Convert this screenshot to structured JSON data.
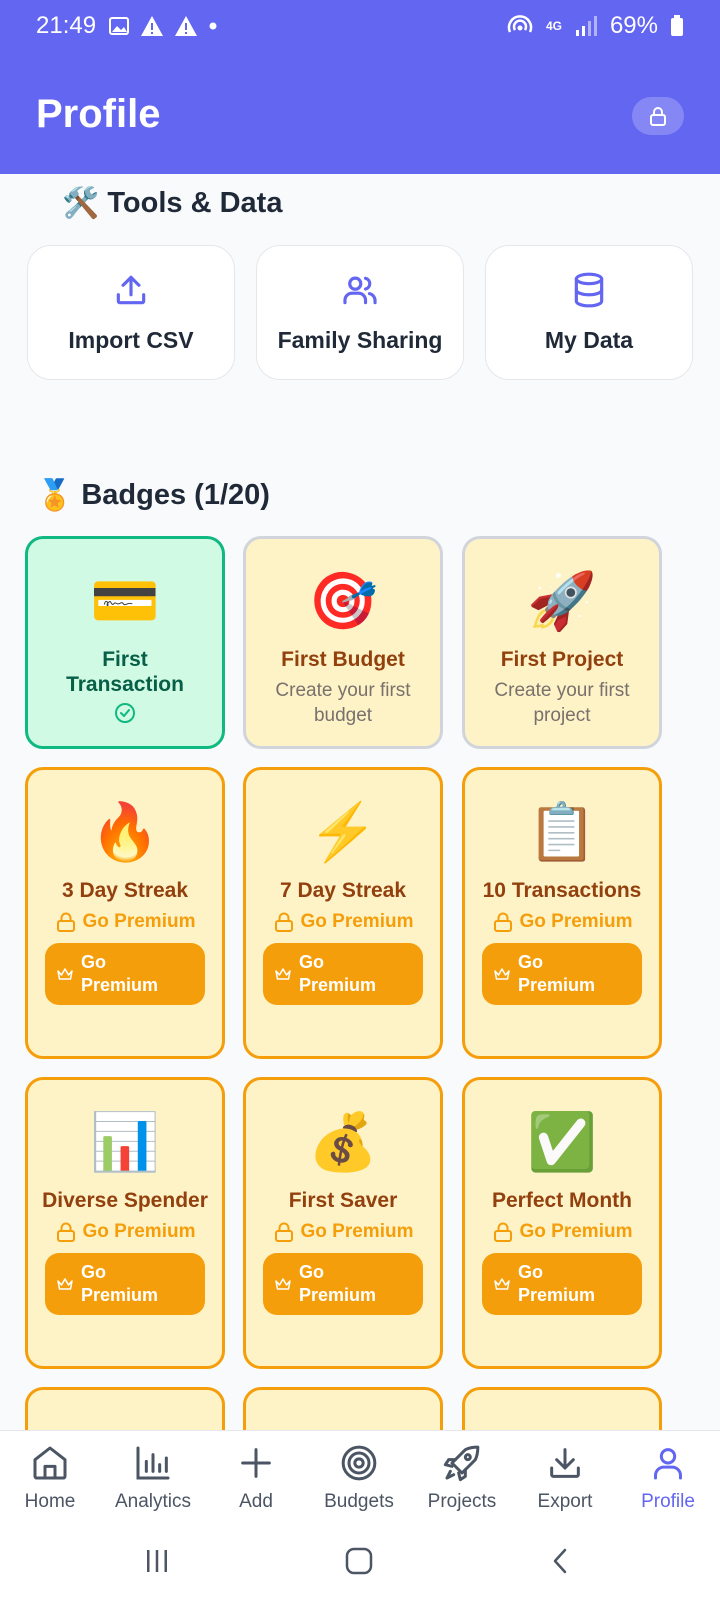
{
  "status_bar": {
    "time": "21:49",
    "battery": "69%",
    "network": "4G"
  },
  "header": {
    "title": "Profile"
  },
  "tools": {
    "title": "Tools & Data",
    "title_emoji": "🛠️",
    "items": [
      {
        "label": "Import CSV",
        "icon": "upload-icon"
      },
      {
        "label": "Family Sharing",
        "icon": "users-icon"
      },
      {
        "label": "My Data",
        "icon": "database-icon"
      }
    ]
  },
  "badges": {
    "title": "Badges (1/20)",
    "title_emoji": "🏅",
    "lock_text": "Go Premium",
    "button_text": "Go Premium",
    "items": [
      {
        "name": "First Transaction",
        "emoji": "💳",
        "status": "earned"
      },
      {
        "name": "First Budget",
        "emoji": "🎯",
        "desc": "Create your first budget",
        "status": "locked"
      },
      {
        "name": "First Project",
        "emoji": "🚀",
        "desc": "Create your first project",
        "status": "locked"
      },
      {
        "name": "3 Day Streak",
        "emoji": "🔥",
        "status": "premium"
      },
      {
        "name": "7 Day Streak",
        "emoji": "⚡",
        "status": "premium"
      },
      {
        "name": "10 Transactions",
        "emoji": "📋",
        "status": "premium"
      },
      {
        "name": "Diverse Spender",
        "emoji": "📊",
        "status": "premium"
      },
      {
        "name": "First Saver",
        "emoji": "💰",
        "status": "premium"
      },
      {
        "name": "Perfect Month",
        "emoji": "✅",
        "status": "premium"
      }
    ]
  },
  "bottom_nav": {
    "active": "Profile",
    "items": [
      {
        "label": "Home",
        "icon": "home-icon"
      },
      {
        "label": "Analytics",
        "icon": "bar-chart-icon"
      },
      {
        "label": "Add",
        "icon": "plus-icon"
      },
      {
        "label": "Budgets",
        "icon": "target-icon"
      },
      {
        "label": "Projects",
        "icon": "rocket-icon"
      },
      {
        "label": "Export",
        "icon": "download-icon"
      },
      {
        "label": "Profile",
        "icon": "user-icon"
      }
    ]
  },
  "colors": {
    "accent": "#6366f1",
    "premium": "#f59e0b",
    "earned": "#10b981",
    "badge_bg": "#fef3c7"
  }
}
